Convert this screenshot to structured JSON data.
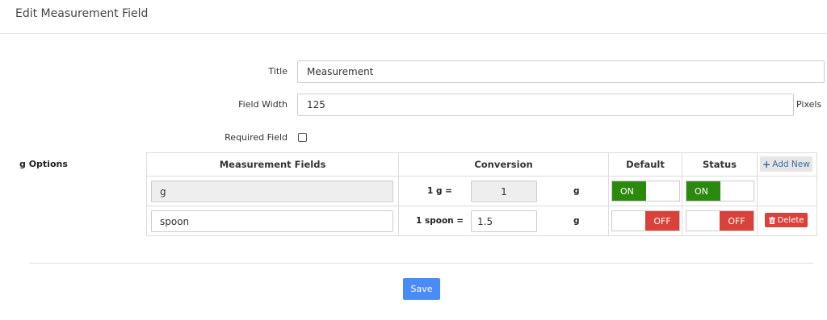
{
  "header": {
    "title": "Edit Measurement Field"
  },
  "form": {
    "title_label": "Title",
    "title_value": "Measurement",
    "width_label": "Field Width",
    "width_value": "125",
    "width_unit": "Pixels",
    "required_label": "Required Field",
    "required_checked": false
  },
  "options": {
    "section_label": "g Options",
    "columns": [
      "Measurement Fields",
      "Conversion",
      "Default",
      "Status"
    ],
    "add_label": "Add New",
    "rows": [
      {
        "field": "g",
        "readonly": true,
        "conv_label": "1 g =",
        "conv_value": "1",
        "unit": "g",
        "default": "ON",
        "status": "ON"
      },
      {
        "field": "spoon",
        "readonly": false,
        "conv_label": "1 spoon =",
        "conv_value": "1.5",
        "unit": "g",
        "default": "OFF",
        "status": "OFF",
        "delete_label": "Delete"
      }
    ]
  },
  "footer": {
    "save_label": "Save"
  },
  "colors": {
    "on": "#2b8a0e",
    "off": "#d9413b",
    "primary": "#4a8cf7"
  }
}
